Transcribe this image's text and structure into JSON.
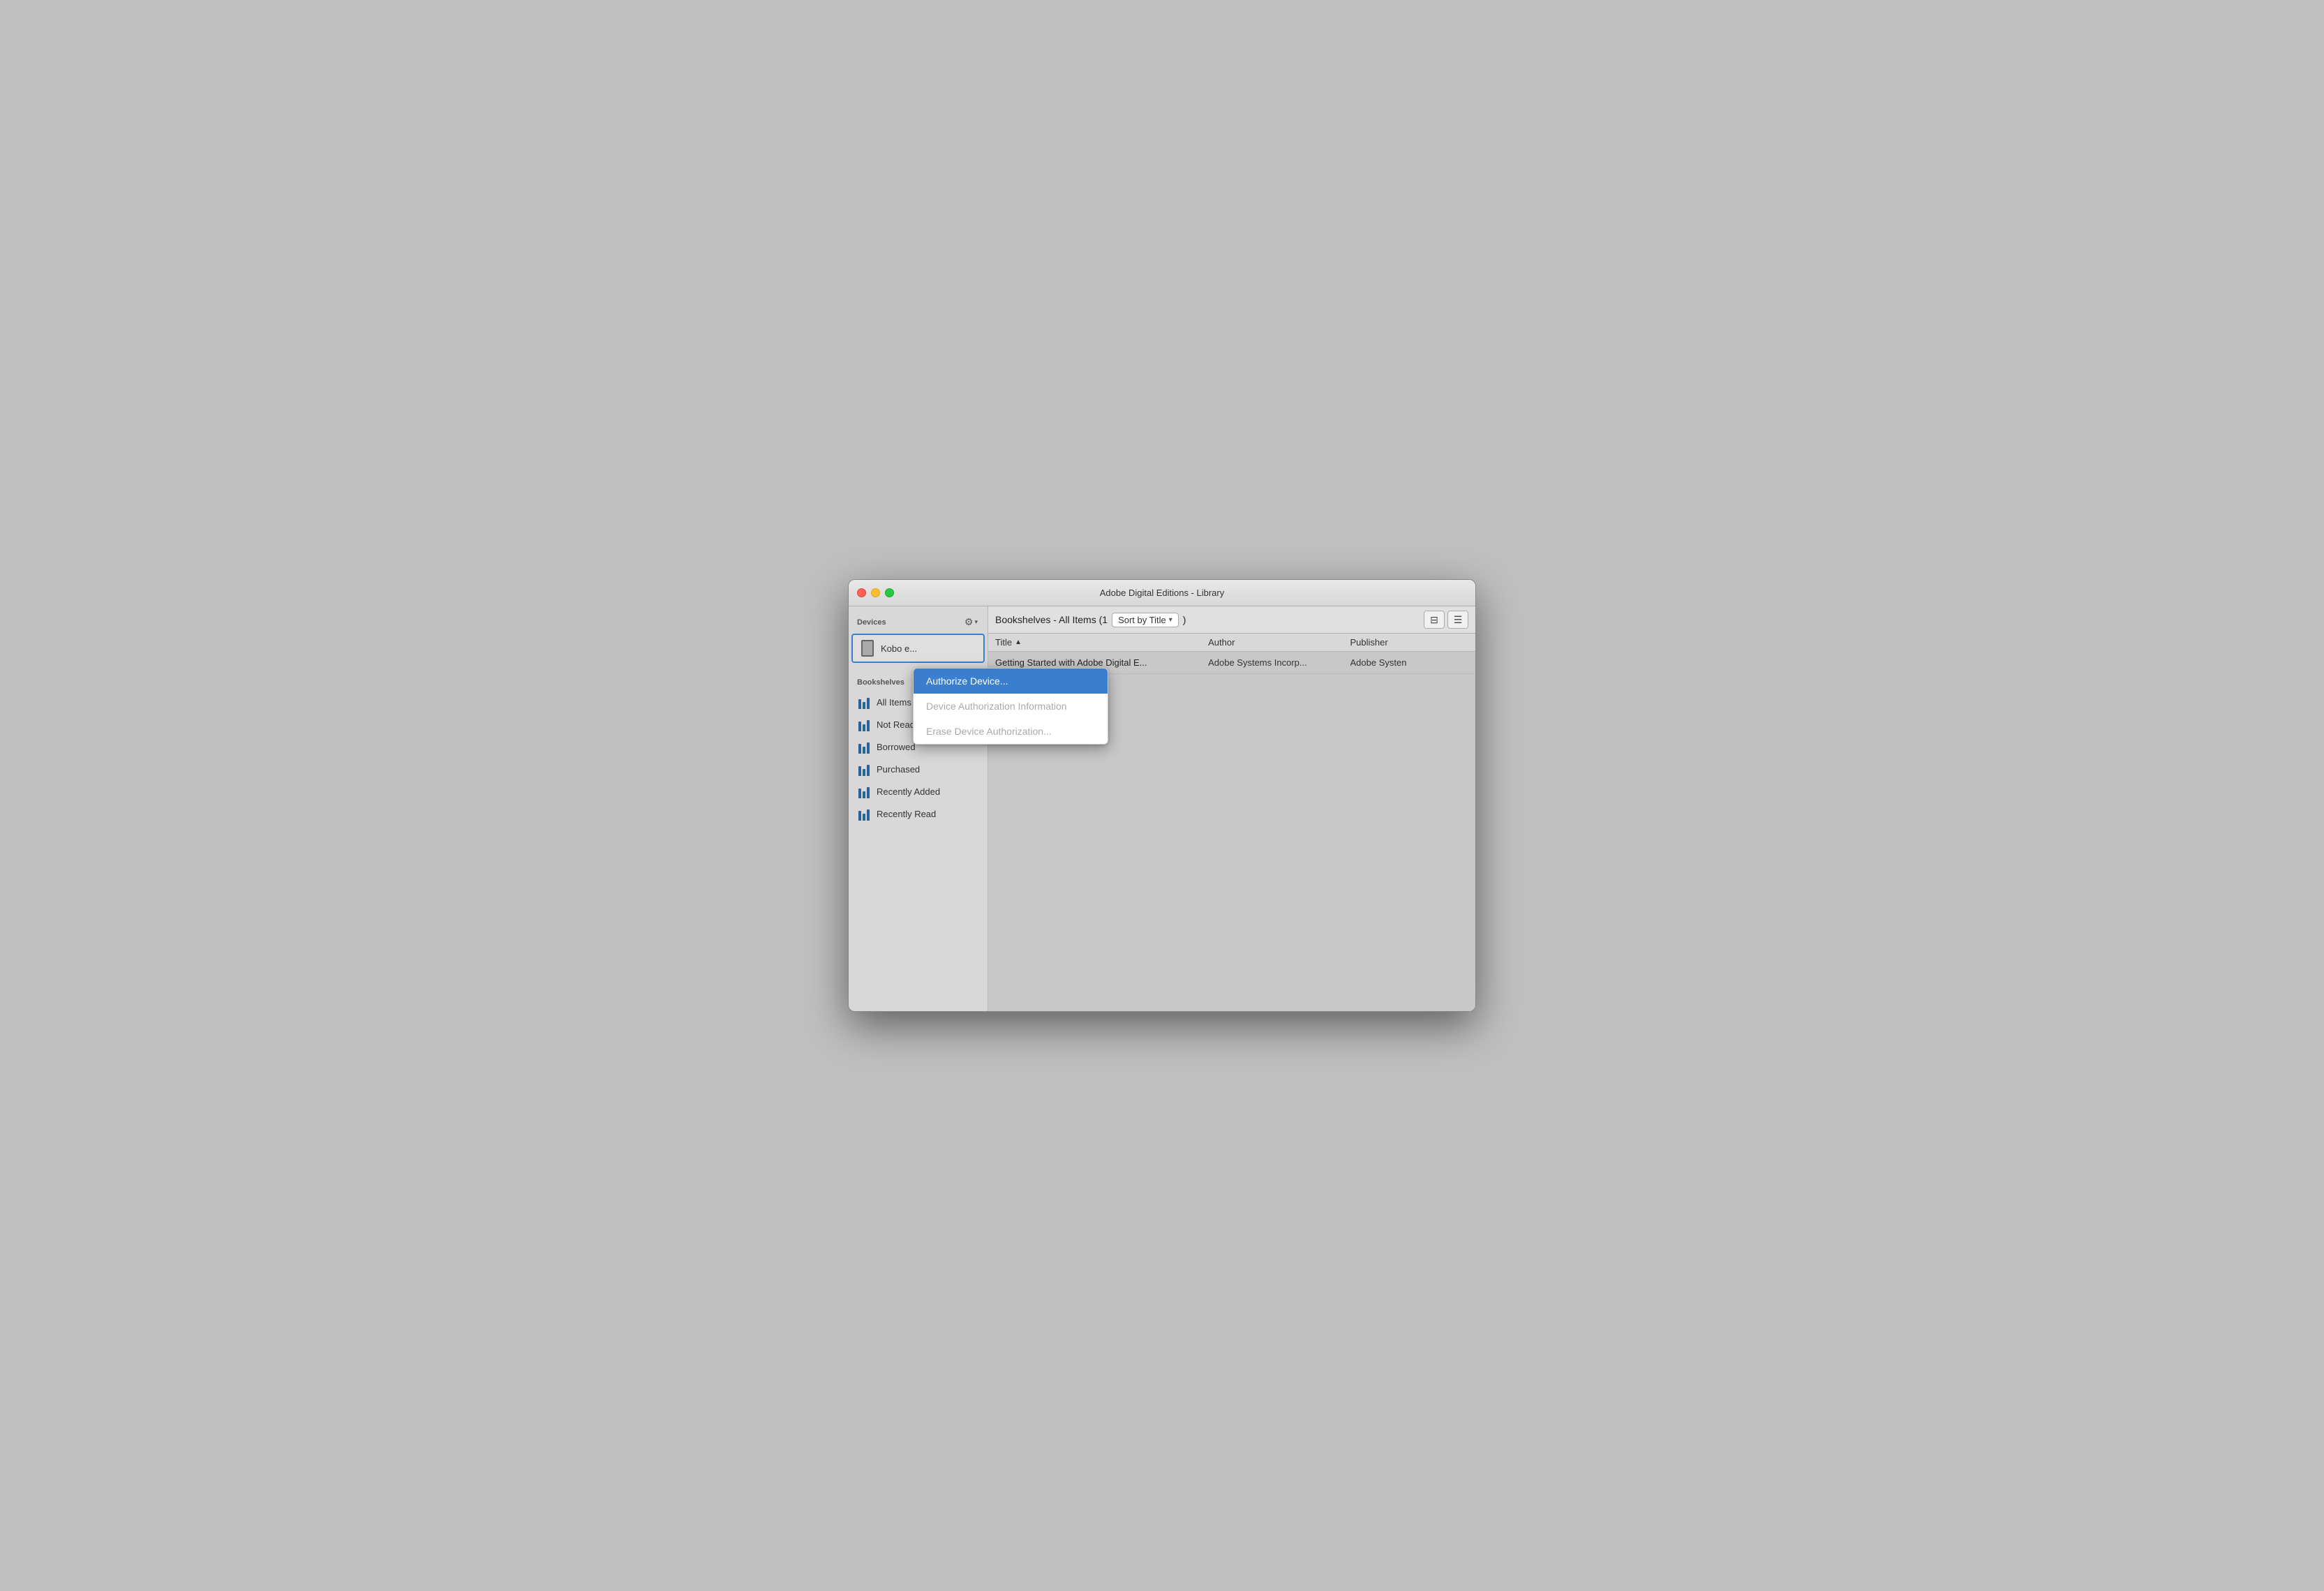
{
  "window": {
    "title": "Adobe Digital Editions - Library"
  },
  "sidebar": {
    "devices_label": "Devices",
    "device_name": "Kobo e...",
    "bookshelves_label": "Bookshelves",
    "items": [
      {
        "label": "All Items"
      },
      {
        "label": "Not Read"
      },
      {
        "label": "Borrowed"
      },
      {
        "label": "Purchased"
      },
      {
        "label": "Recently Added"
      },
      {
        "label": "Recently Read"
      }
    ]
  },
  "content": {
    "header_prefix": "Bookshelves - All Items (1",
    "sort_label": "Sort by Title",
    "columns": {
      "title": "Title",
      "author": "Author",
      "publisher": "Publisher"
    },
    "rows": [
      {
        "title": "Getting Started with Adobe Digital E...",
        "author": "Adobe Systems Incorp...",
        "publisher": "Adobe Systen"
      }
    ]
  },
  "context_menu": {
    "items": [
      {
        "label": "Authorize Device...",
        "state": "active"
      },
      {
        "label": "Device Authorization Information",
        "state": "disabled"
      },
      {
        "label": "Erase Device Authorization...",
        "state": "disabled"
      }
    ]
  },
  "view_buttons": {
    "list_detail": "☰",
    "list_compact": "≡"
  },
  "icons": {
    "gear": "⚙",
    "chevron_down": "▾",
    "sort_asc": "▲",
    "dropdown_arrow": "▾",
    "plus": "+",
    "minus": "−"
  }
}
